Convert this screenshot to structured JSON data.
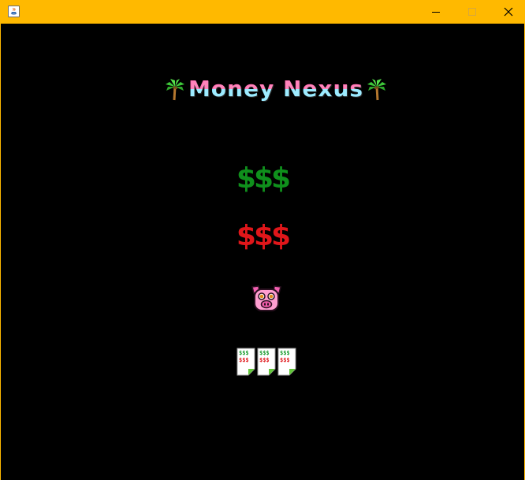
{
  "window": {
    "titlebar_color": "#ffb900",
    "icons": {
      "app": "java-app-icon",
      "minimize": "minimize-icon",
      "maximize": "maximize-icon",
      "close": "close-icon"
    }
  },
  "game": {
    "title": "Money Nexus",
    "title_colors": [
      "#ff6fb0",
      "#8ee8ff"
    ],
    "decor_icons": [
      "palm-tree-icon",
      "palm-tree-icon"
    ],
    "green_symbols": "$$$",
    "green_color": "#0f8f1c",
    "red_symbols": "$$$",
    "red_color": "#e0161a",
    "pig_icon": "piggy-bank-pig-icon",
    "receipt_icons": [
      "receipt-icon",
      "receipt-icon",
      "receipt-icon"
    ],
    "receipt_marks": {
      "green": "$$$",
      "red": "$$$"
    }
  }
}
